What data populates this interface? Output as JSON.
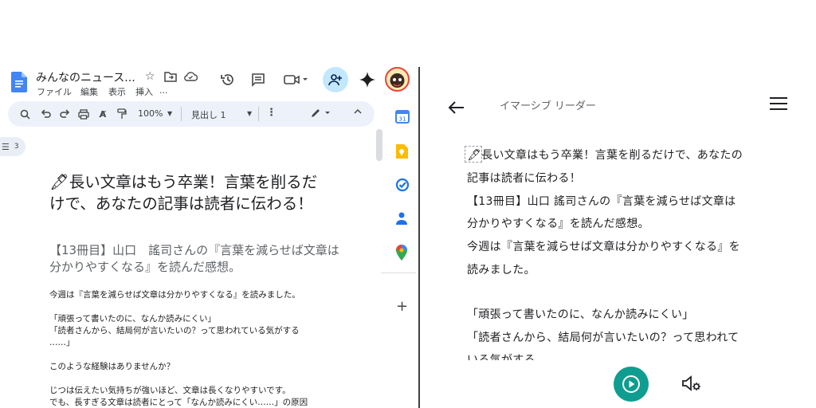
{
  "docs": {
    "title": "みんなのニュース...",
    "menu": [
      "ファイル",
      "編集",
      "表示",
      "挿入",
      "..."
    ],
    "toolbar": {
      "zoom": "100%",
      "style": "見出し 1"
    },
    "outline_count": "3",
    "heading": "🖋長い文章はもう卒業！言葉を削るだけで、あなたの記事は読者に伝わる！",
    "subtitle": "【13冊目】山口　謠司さんの『言葉を減らせば文章は分かりやすくなる』を読んだ感想。",
    "paragraphs": [
      "今週は『言葉を減らせば文章は分かりやすくなる』を読みました。",
      "「頑張って書いたのに、なんか読みにくい」",
      "「読者さんから、結局何が言いたいの？って思われている気がする",
      "……」",
      "このような経験はありませんか？",
      "じつは伝えたい気持ちが強いほど、文章は長くなりやすいです。",
      "でも、長すぎる文章は読者にとって「なんか読みにくい……」の原因"
    ],
    "side_panel": [
      "calendar-icon",
      "keep-icon",
      "tasks-icon",
      "contacts-icon",
      "maps-icon",
      "plus-icon"
    ]
  },
  "reader": {
    "title": "イマーシブ リーダー",
    "lines": [
      "🖋長い文章はもう卒業！言葉を削るだけで、あなたの",
      "記事は読者に伝わる！",
      "【13冊目】山口 謠司さんの『言葉を減らせば文章は",
      "分かりやすくなる』を読んだ感想。",
      "今週は『言葉を減らせば文章は分かりやすくなる』を",
      "読みました。",
      "",
      "「頑張って書いたのに、なんか読みにくい」",
      "「読者さんから、結局何が言いたいの？って思われて",
      "いる気がする"
    ]
  }
}
